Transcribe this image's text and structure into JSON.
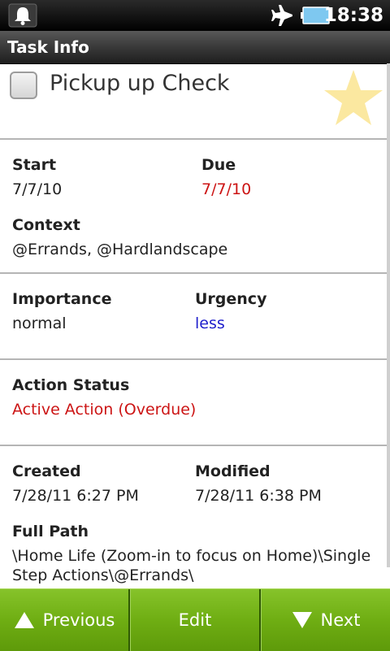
{
  "status_bar": {
    "time": "18:38",
    "icons": [
      "notification-bell-icon",
      "airplane-mode-icon",
      "battery-icon"
    ]
  },
  "title_bar": {
    "title": "Task Info"
  },
  "task": {
    "name": "Pickup up Check",
    "completed": false,
    "starred": true,
    "star_color": "#fbe8a0"
  },
  "fields": {
    "start": {
      "label": "Start",
      "value": "7/7/10"
    },
    "due": {
      "label": "Due",
      "value": "7/7/10",
      "color": "#cc1414"
    },
    "context": {
      "label": "Context",
      "value": "@Errands, @Hardlandscape"
    },
    "importance": {
      "label": "Importance",
      "value": "normal"
    },
    "urgency": {
      "label": "Urgency",
      "value": "less",
      "color": "#2020cc"
    },
    "action_status": {
      "label": "Action Status",
      "value": "Active Action (Overdue)",
      "color": "#cc1414"
    },
    "created": {
      "label": "Created",
      "value": "7/28/11 6:27 PM"
    },
    "modified": {
      "label": "Modified",
      "value": "7/28/11 6:38 PM"
    },
    "full_path": {
      "label": "Full Path",
      "value": "\\Home Life  (Zoom-in to focus on Home)\\Single Step Actions\\@Errands\\"
    }
  },
  "bottom_bar": {
    "previous_label": "Previous",
    "edit_label": "Edit",
    "next_label": "Next",
    "accent": "#6fae13"
  }
}
